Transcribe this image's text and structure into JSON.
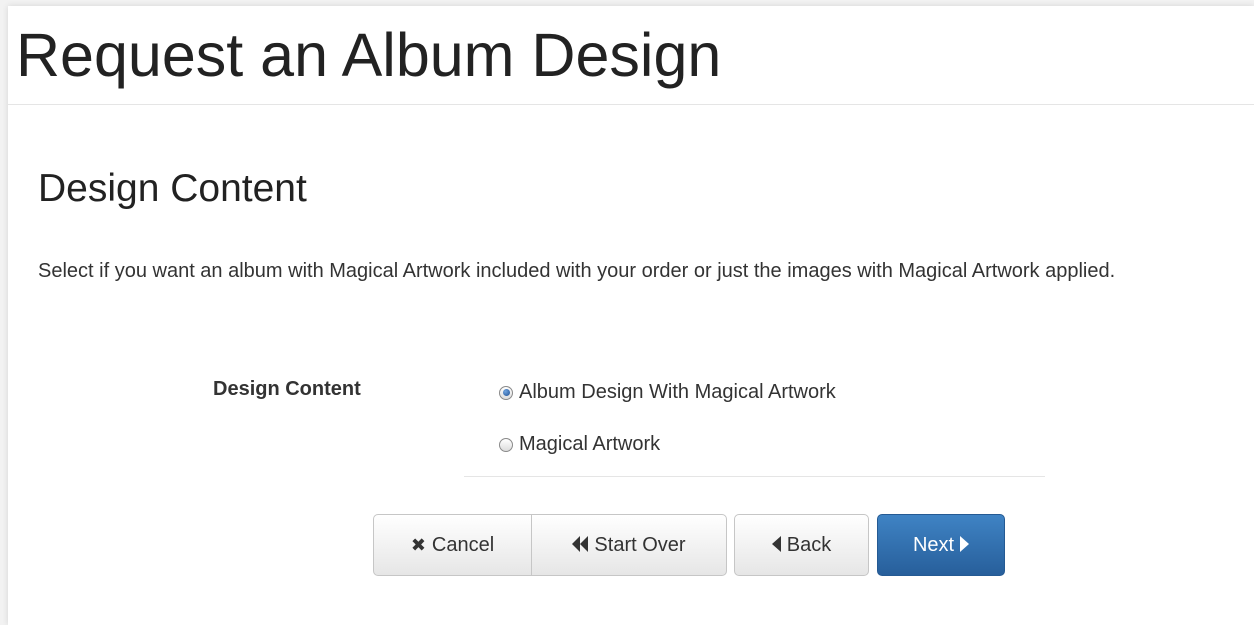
{
  "page": {
    "title": "Request an Album Design"
  },
  "section": {
    "title": "Design Content",
    "description": "Select if you want an album with Magical Artwork included with your order or just the images with Magical Artwork applied."
  },
  "form": {
    "label": "Design Content",
    "options": [
      {
        "label": "Album Design With Magical Artwork",
        "selected": true
      },
      {
        "label": "Magical Artwork",
        "selected": false
      }
    ]
  },
  "buttons": {
    "cancel": {
      "label": "Cancel",
      "icon": "close-icon"
    },
    "start_over": {
      "label": "Start Over",
      "icon": "fast-backward-icon"
    },
    "back": {
      "label": "Back",
      "icon": "caret-left-icon"
    },
    "next": {
      "label": "Next",
      "icon": "caret-right-icon"
    }
  },
  "colors": {
    "primary": "#2f6fae",
    "radio_selected": "#1f4f93",
    "border": "#c6c6c6"
  }
}
